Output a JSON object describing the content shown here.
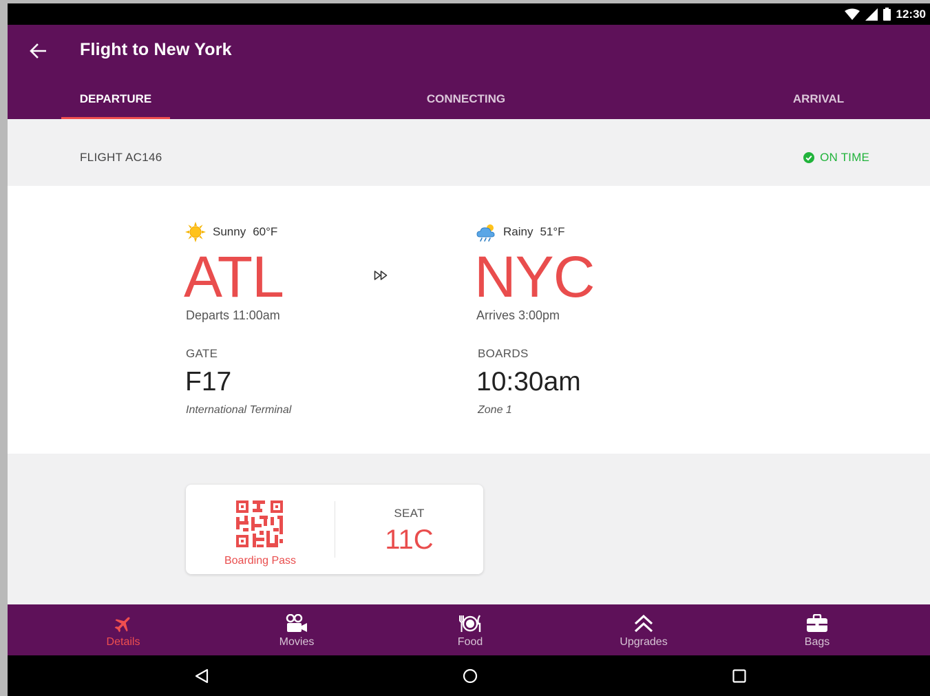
{
  "status_bar": {
    "time": "12:30"
  },
  "app_bar": {
    "title": "Flight to New York"
  },
  "tabs": [
    {
      "label": "DEPARTURE",
      "active": true
    },
    {
      "label": "CONNECTING",
      "active": false
    },
    {
      "label": "ARRIVAL",
      "active": false
    }
  ],
  "flight": {
    "number": "FLIGHT AC146",
    "status": "ON TIME",
    "status_color": "#21b33b"
  },
  "departure": {
    "weather_icon": "sun-icon",
    "weather_condition": "Sunny",
    "weather_temp": "60°F",
    "code": "ATL",
    "time_text": "Departs 11:00am",
    "gate_label": "GATE",
    "gate_value": "F17",
    "gate_sub": "International Terminal"
  },
  "arrival": {
    "weather_icon": "rain-cloud-icon",
    "weather_condition": "Rainy",
    "weather_temp": "51°F",
    "code": "NYC",
    "time_text": "Arrives 3:00pm",
    "boards_label": "BOARDS",
    "boards_value": "10:30am",
    "boards_sub": "Zone 1"
  },
  "boarding_pass": {
    "label": "Boarding Pass",
    "seat_label": "SEAT",
    "seat_value": "11C"
  },
  "bottom_nav": [
    {
      "label": "Details",
      "icon": "airplane-icon",
      "active": true
    },
    {
      "label": "Movies",
      "icon": "movie-camera-icon",
      "active": false
    },
    {
      "label": "Food",
      "icon": "plate-cutlery-icon",
      "active": false
    },
    {
      "label": "Upgrades",
      "icon": "double-chevron-up-icon",
      "active": false
    },
    {
      "label": "Bags",
      "icon": "briefcase-icon",
      "active": false
    }
  ],
  "colors": {
    "brand": "#5e1159",
    "accent": "#e94d4d",
    "background": "#f1f1f2"
  }
}
